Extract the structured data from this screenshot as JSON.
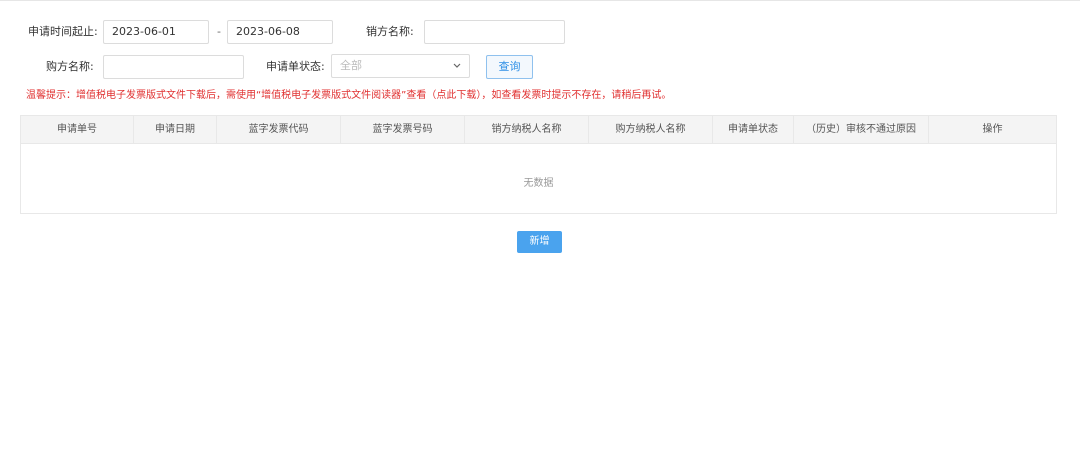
{
  "filters": {
    "date_range_label": "申请时间起止:",
    "date_start": "2023-06-01",
    "date_separator": "-",
    "date_end": "2023-06-08",
    "seller_name_label": "销方名称:",
    "seller_name_value": "",
    "buyer_name_label": "购方名称:",
    "buyer_name_value": "",
    "status_label": "申请单状态:",
    "status_selected": "全部",
    "query_button": "查询"
  },
  "tip": "温馨提示：增值税电子发票版式文件下载后，需使用“增值税电子发票版式文件阅读器”查看（点此下载），如查看发票时提示不存在，请稍后再试。",
  "table": {
    "columns": [
      "申请单号",
      "申请日期",
      "蓝字发票代码",
      "蓝字发票号码",
      "销方纳税人名称",
      "购方纳税人名称",
      "申请单状态",
      "（历史）审核不通过原因",
      "操作"
    ],
    "empty_text": "无数据"
  },
  "actions": {
    "add_button": "新增"
  },
  "colors": {
    "tip_red": "#e03030",
    "primary_blue": "#4aa3ee",
    "header_bg": "#f4f4f4"
  }
}
